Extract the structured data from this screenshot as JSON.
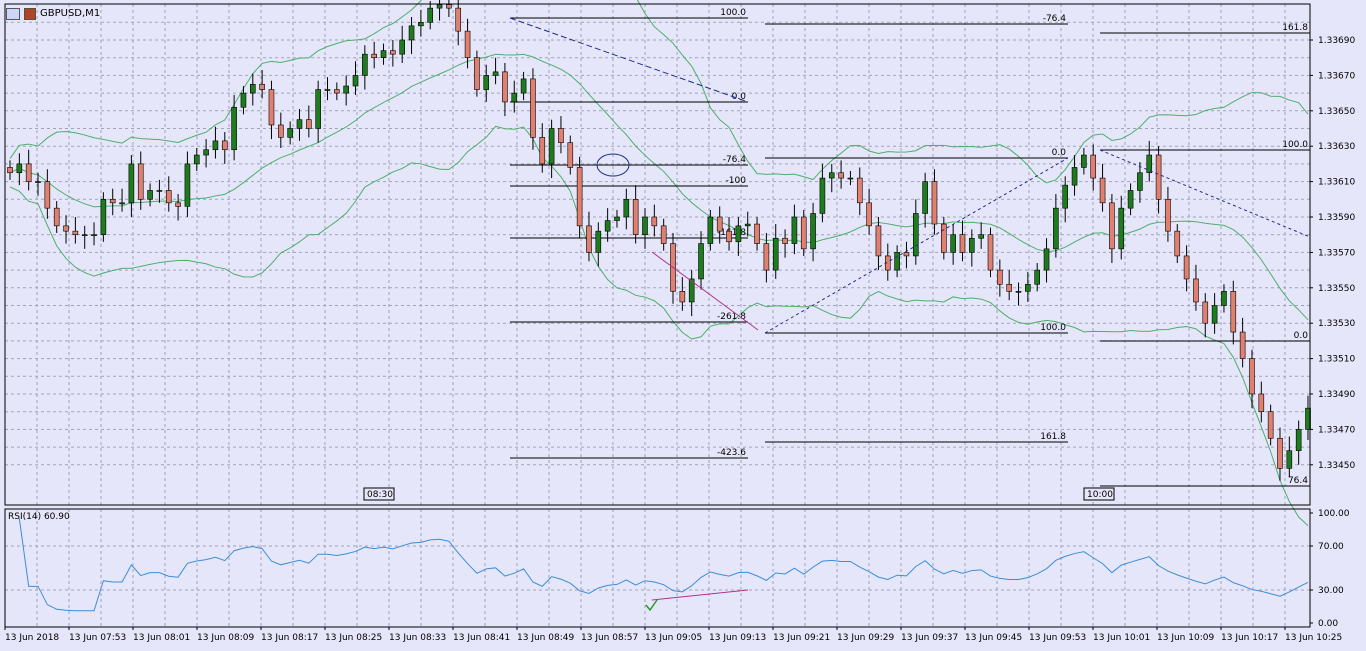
{
  "window": {
    "title": "GBPUSD,M1",
    "icons": [
      "chart-window-icon",
      "chart-type-icon"
    ]
  },
  "colors": {
    "background": "#e6e6fa",
    "grid": "#9fa3b8",
    "bull_candle": "#1e7b1e",
    "bear_candle": "#e08070",
    "bollinger": "#4caf6a",
    "rsi_line": "#3b8ed8",
    "divergence": "#b0348c",
    "trend_dashed": "#1b2f8c"
  },
  "chart_data": [
    {
      "type": "candlestick",
      "name": "price",
      "price_axis": {
        "ticks": [
          "1.33690",
          "1.33670",
          "1.33650",
          "1.33630",
          "1.33610",
          "1.33590",
          "1.33570",
          "1.33550",
          "1.33530",
          "1.33510",
          "1.33490",
          "1.33470",
          "1.33450"
        ],
        "range": [
          1.3343,
          1.3371
        ]
      },
      "time_axis": {
        "ticks": [
          "13 Jun 2018",
          "13 Jun 07:53",
          "13 Jun 08:01",
          "13 Jun 08:09",
          "13 Jun 08:17",
          "13 Jun 08:25",
          "13 Jun 08:33",
          "13 Jun 08:41",
          "13 Jun 08:49",
          "13 Jun 08:57",
          "13 Jun 09:05",
          "13 Jun 09:13",
          "13 Jun 09:21",
          "13 Jun 09:29",
          "13 Jun 09:37",
          "13 Jun 09:45",
          "13 Jun 09:53",
          "13 Jun 10:01",
          "13 Jun 10:09",
          "13 Jun 10:17",
          "13 Jun 10:25"
        ]
      },
      "session_markers": [
        "08:30",
        "10:00"
      ],
      "close": [
        1.33615,
        1.3362,
        1.3361,
        1.3361,
        1.33595,
        1.33585,
        1.33582,
        1.3358,
        1.3358,
        1.3358,
        1.336,
        1.33598,
        1.33598,
        1.3362,
        1.336,
        1.33605,
        1.33605,
        1.33598,
        1.33596,
        1.3362,
        1.33625,
        1.33628,
        1.33633,
        1.33628,
        1.33652,
        1.3366,
        1.33665,
        1.33662,
        1.33642,
        1.33635,
        1.3364,
        1.33645,
        1.3364,
        1.33662,
        1.33662,
        1.3366,
        1.33664,
        1.3367,
        1.33682,
        1.3368,
        1.33684,
        1.33682,
        1.3369,
        1.33698,
        1.337,
        1.33708,
        1.3371,
        1.33708,
        1.33695,
        1.3368,
        1.33662,
        1.3367,
        1.33672,
        1.33655,
        1.3366,
        1.33668,
        1.33635,
        1.3362,
        1.3364,
        1.33632,
        1.33618,
        1.33585,
        1.3357,
        1.33582,
        1.33588,
        1.3359,
        1.336,
        1.3358,
        1.3359,
        1.33585,
        1.33575,
        1.33548,
        1.33542,
        1.33555,
        1.33575,
        1.3359,
        1.33582,
        1.33576,
        1.33585,
        1.33586,
        1.33575,
        1.3356,
        1.33578,
        1.33575,
        1.3359,
        1.33572,
        1.33592,
        1.33612,
        1.33615,
        1.33612,
        1.33612,
        1.33598,
        1.33585,
        1.33568,
        1.3356,
        1.3357,
        1.33568,
        1.33592,
        1.3361,
        1.33586,
        1.3357,
        1.3358,
        1.3357,
        1.33578,
        1.3358,
        1.3356,
        1.33552,
        1.33548,
        1.33548,
        1.33552,
        1.3356,
        1.33572,
        1.33595,
        1.33608,
        1.33618,
        1.33625,
        1.33612,
        1.33598,
        1.33572,
        1.33595,
        1.33605,
        1.33615,
        1.33625,
        1.336,
        1.33582,
        1.33568,
        1.33555,
        1.33542,
        1.3353,
        1.3354,
        1.33548,
        1.33525,
        1.3351,
        1.3349,
        1.3348,
        1.33465,
        1.33448,
        1.33458,
        1.3347,
        1.33482
      ],
      "fibonacci": [
        {
          "group": "left",
          "levels": [
            "100.0",
            "0.0",
            "-76.4",
            "-100",
            "-161.8",
            "-261.8",
            "-423.6"
          ]
        },
        {
          "group": "middle",
          "levels": [
            "-76.4",
            "0.0",
            "100.0",
            "161.8"
          ]
        },
        {
          "group": "right",
          "levels": [
            "161.8",
            "100.0",
            "0.0",
            "76.4"
          ]
        }
      ]
    },
    {
      "type": "line",
      "name": "RSI(14)",
      "label": "RSI(14) 60.90",
      "axis": {
        "ticks": [
          "100.00",
          "70.00",
          "30.00",
          "0.00"
        ],
        "range": [
          0,
          100
        ]
      },
      "levels": [
        70,
        30
      ]
    }
  ]
}
